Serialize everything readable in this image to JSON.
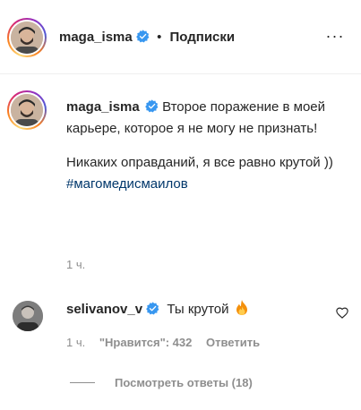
{
  "header": {
    "username": "maga_isma",
    "separator": "•",
    "follow_label": "Подписки",
    "more_label": "···"
  },
  "post": {
    "username": "maga_isma",
    "caption_line1": "Второе поражение в моей карьере, которое я не могу не признать!",
    "caption_line2": "Никаких оправданий, я все равно крутой ))",
    "hashtag": "#магомедисмаилов",
    "time": "1 ч."
  },
  "comment": {
    "username": "selivanov_v",
    "text": "Ты крутой",
    "emoji": "fire",
    "time": "1 ч.",
    "likes": "\"Нравится\": 432",
    "reply_label": "Ответить",
    "view_replies": "Посмотреть ответы (18)"
  },
  "icons": {
    "verified": "verified-badge-icon",
    "like": "heart-icon",
    "more": "more-options-icon"
  },
  "colors": {
    "text": "#262626",
    "secondary": "#8e8e8e",
    "hashtag": "#00376b",
    "verified": "#3897f0"
  }
}
